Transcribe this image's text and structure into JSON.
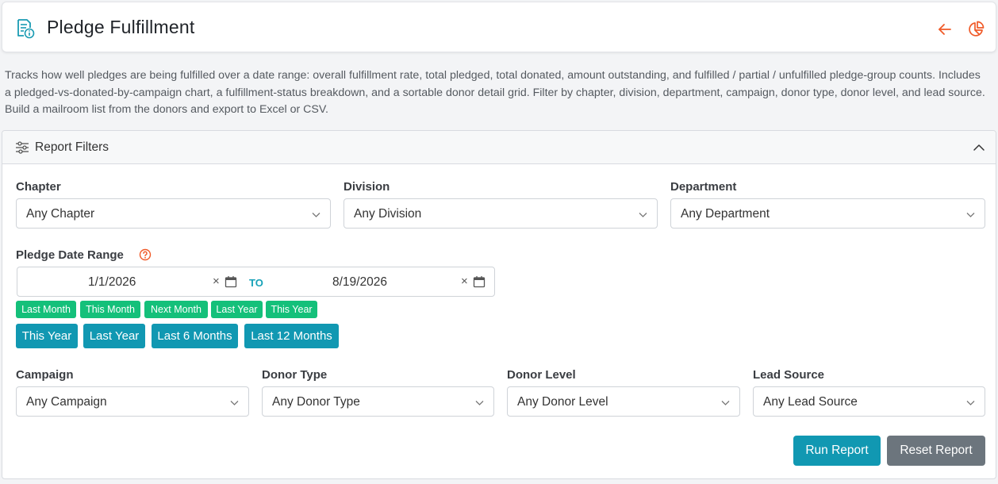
{
  "header": {
    "title": "Pledge Fulfillment",
    "icon": "report-info-icon",
    "accent_color": "#f05a28",
    "icon_color": "#1a9bb3"
  },
  "description": "Tracks how well pledges are being fulfilled over a date range: overall fulfillment rate, total pledged, total donated, amount outstanding, and fulfilled / partial / unfulfilled pledge-group counts. Includes a pledged-vs-donated-by-campaign chart, a fulfillment-status breakdown, and a sortable donor detail grid. Filter by chapter, division, department, campaign, donor type, donor level, and lead source. Build a mailroom list from the donors and export to Excel or CSV.",
  "filters": {
    "title": "Report Filters",
    "chapter": {
      "label": "Chapter",
      "value": "Any Chapter"
    },
    "division": {
      "label": "Division",
      "value": "Any Division"
    },
    "department": {
      "label": "Department",
      "value": "Any Department"
    },
    "pledge_date_range": {
      "label": "Pledge Date Range",
      "from": "1/1/2026",
      "to_label": "TO",
      "to": "8/19/2026",
      "clear_glyph": "×"
    },
    "chips": [
      "Last Month",
      "This Month",
      "Next Month",
      "Last Year",
      "This Year"
    ],
    "quick_buttons": [
      "This Year",
      "Last Year",
      "Last 6 Months",
      "Last 12 Months"
    ],
    "campaign": {
      "label": "Campaign",
      "value": "Any Campaign"
    },
    "donor_type": {
      "label": "Donor Type",
      "value": "Any Donor Type"
    },
    "donor_level": {
      "label": "Donor Level",
      "value": "Any Donor Level"
    },
    "lead_source": {
      "label": "Lead Source",
      "value": "Any Lead Source"
    }
  },
  "actions": {
    "run": "Run Report",
    "reset": "Reset Report"
  },
  "colors": {
    "primary": "#1198b2",
    "success": "#14c07a",
    "secondary": "#6c757d"
  }
}
